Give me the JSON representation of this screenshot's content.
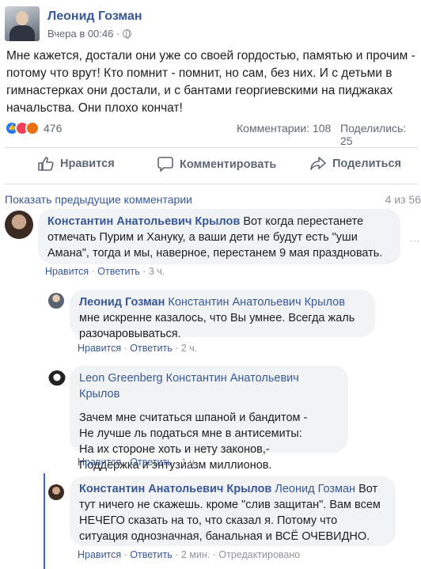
{
  "post": {
    "author": "Леонид Гозман",
    "meta_time": "Вчера в 00:46 ·",
    "text": "Мне кажется, достали они уже со своей гордостью, памятью и прочим - потому что врут! Кто помнит - помнит, но сам, без них. И с детьми в гимнастерках они достали, и с бантами георгиевскими на пиджаках начальства. Они плохо кончат!",
    "reactions_count": "476",
    "comments_count": "Комментарии: 108",
    "shares_count": "Поделились: 25"
  },
  "actions": {
    "like": "Нравится",
    "comment": "Комментировать",
    "share": "Поделиться"
  },
  "comments_header": {
    "show_previous": "Показать предыдущие комментарии",
    "count": "4 из 56"
  },
  "comments": [
    {
      "author": "Константин Анатольевич Крылов",
      "mention": "",
      "text": "Вот когда перестанете отмечать Пурим и Хануку, а ваши дети не будут есть \"уши Амана\", тогда и мы, наверное, перестанем 9 мая праздновать.",
      "like": "Нравится",
      "reply": "Ответить",
      "time": "3 ч."
    },
    {
      "author": "Леонид Гозман",
      "mention": "Константин Анатольевич Крылов",
      "text": "мне искренне казалось, что Вы умнее. Всегда жаль разочаровываться.",
      "like": "Нравится",
      "reply": "Ответить",
      "time": "2 ч."
    },
    {
      "author": "Leon Greenberg",
      "mention": "Константин Анатольевич Крылов",
      "lines": [
        "Зачем мне считаться шпаной и бандитом -",
        "Не лучше ль податься мне в антисемиты:",
        "На их стороне хоть и нету законов,-",
        "Поддержка и энтузиазм миллионов."
      ],
      "like": "Нравится",
      "reply": "Ответить",
      "time": "1 ч."
    },
    {
      "author": "Константин Анатольевич Крылов",
      "mention": "Леонид Гозман",
      "text": "Вот тут ничего не скажешь. кроме \"слив защитан\". Вам всем НЕЧЕГО сказать на то, что сказал я. Потому что ситуация однозначная, банальная и ВСЁ ОЧЕВИДНО.",
      "like": "Нравится",
      "reply": "Ответить",
      "time": "2 мин.",
      "edited": "Отредактировано"
    }
  ],
  "colors": {
    "link": "#385898",
    "bubble": "#f2f3f5",
    "muted": "#90949c",
    "thread": "#4267b2"
  },
  "icons": [
    "globe-icon",
    "like-reaction-icon",
    "love-reaction-icon",
    "angry-reaction-icon",
    "thumbs-up-icon",
    "comment-bubble-icon",
    "share-arrow-icon",
    "more-dots-icon"
  ]
}
